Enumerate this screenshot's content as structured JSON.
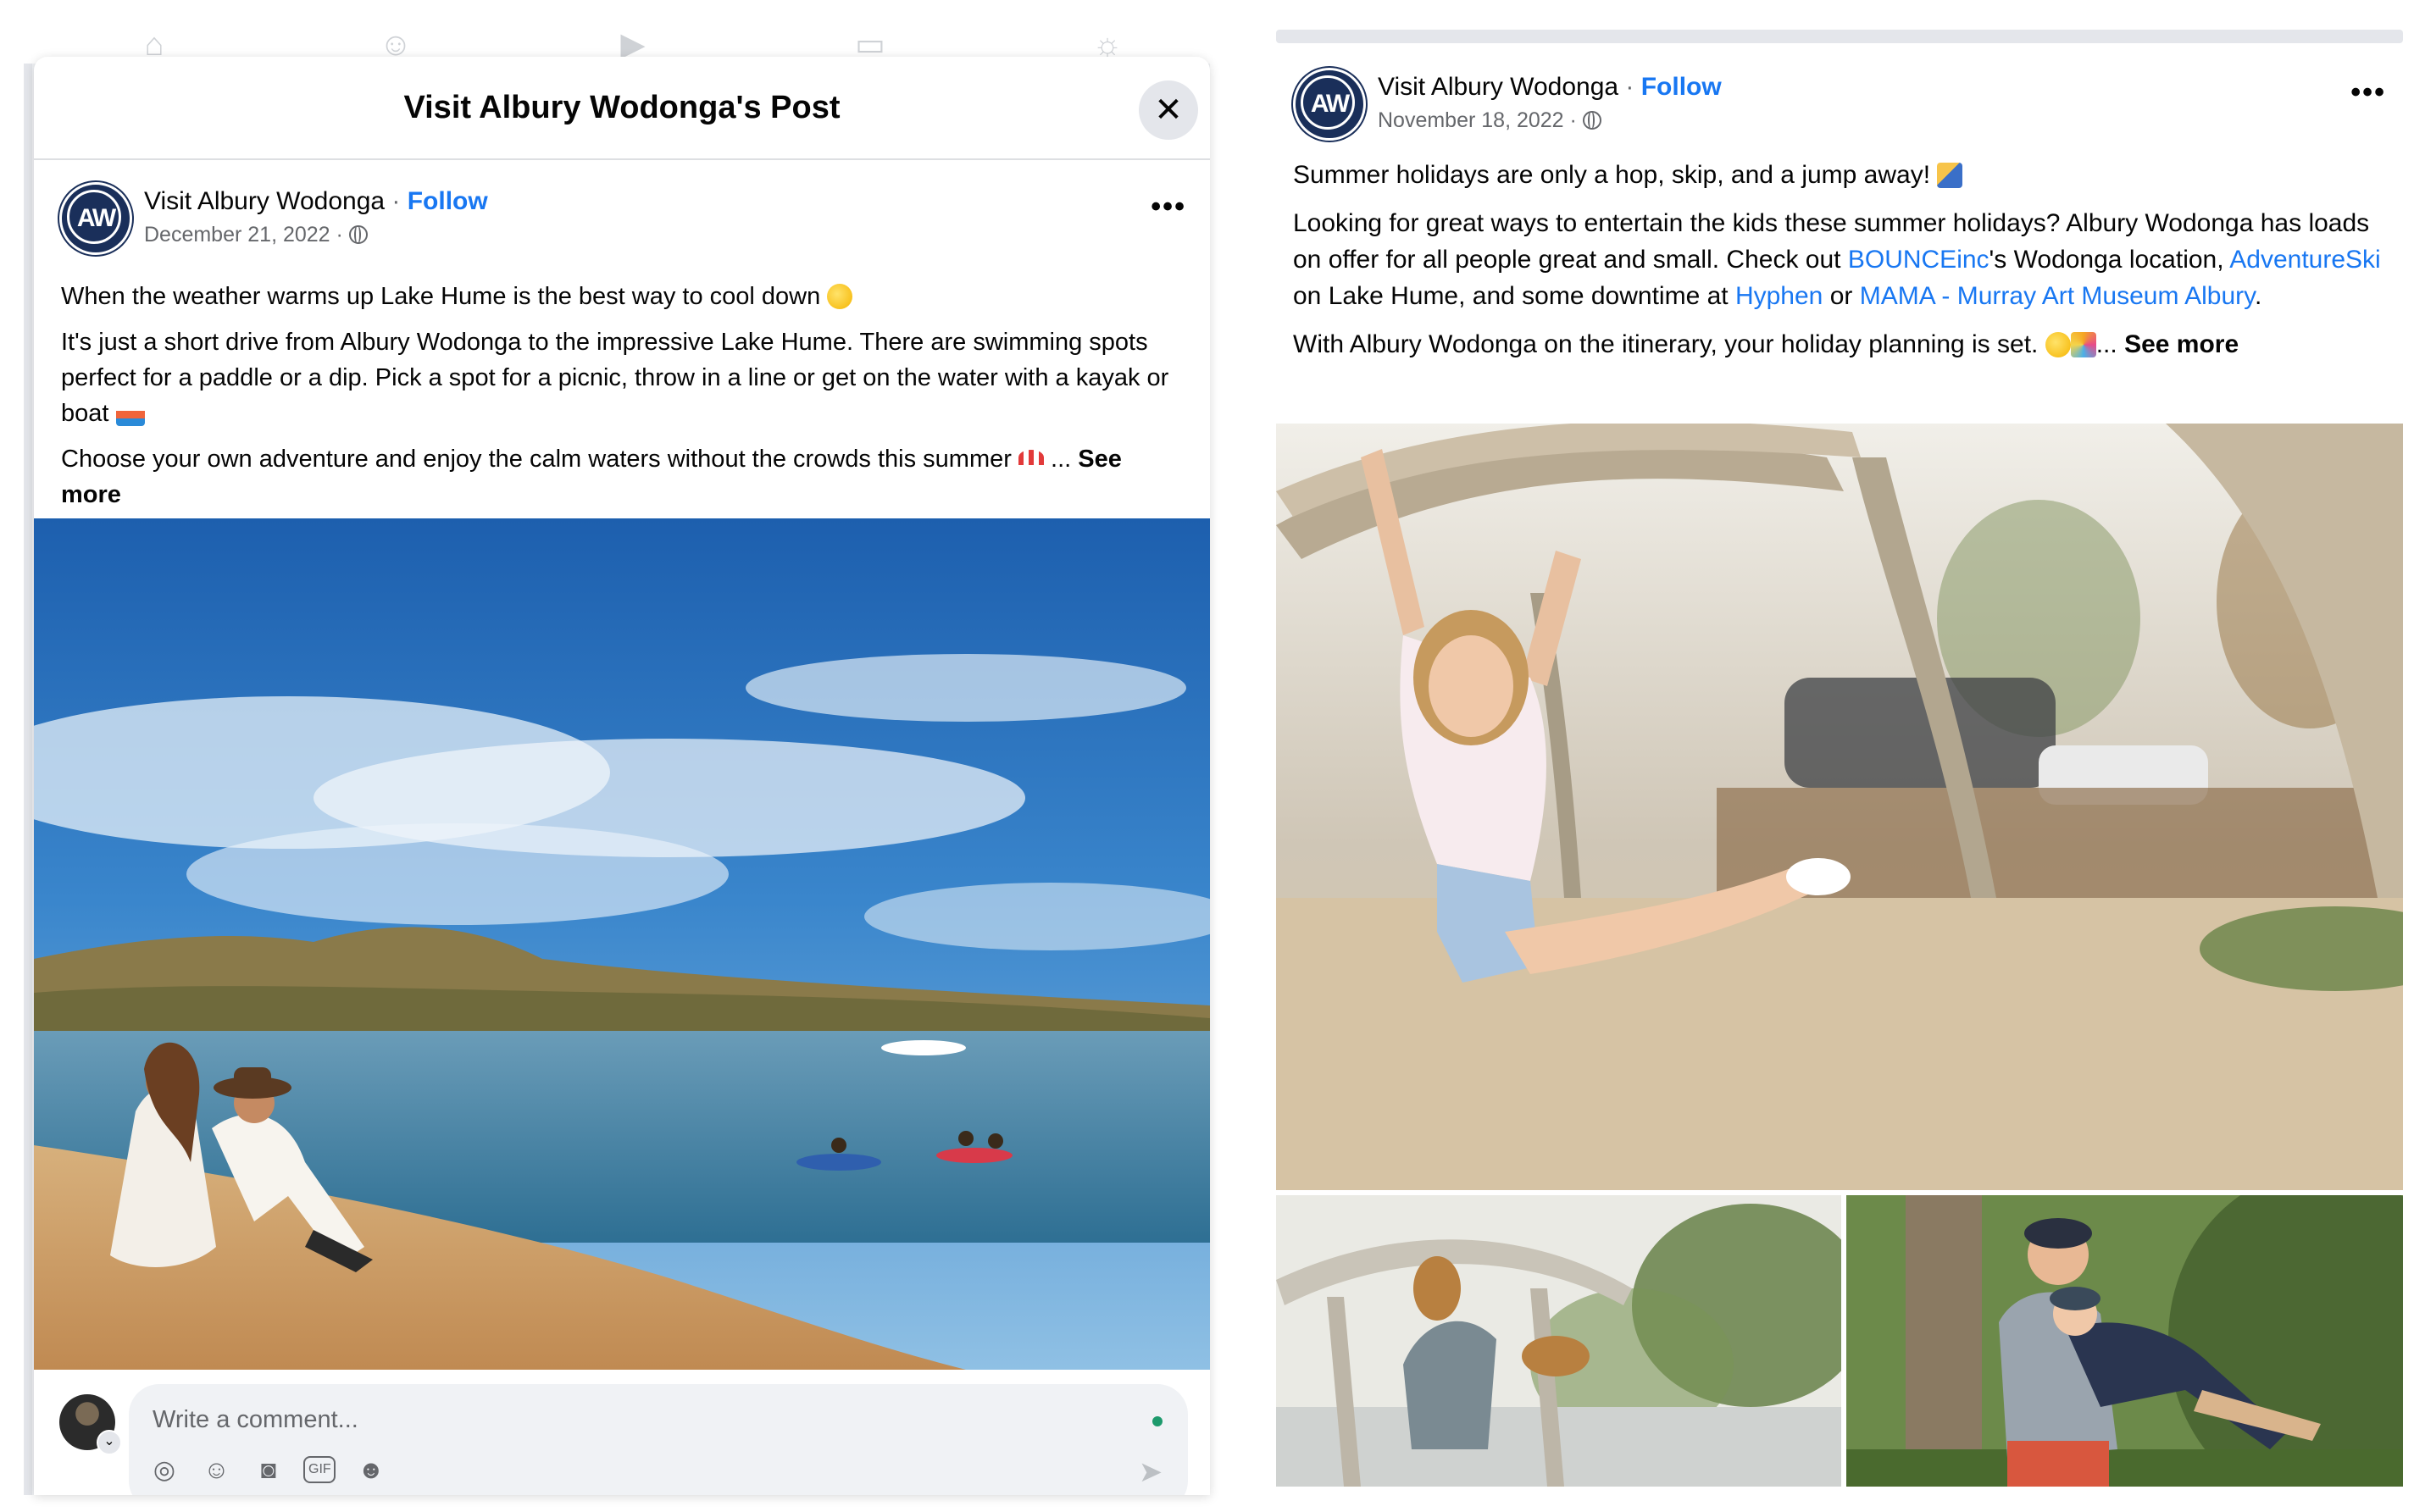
{
  "left_post": {
    "modal_title": "Visit Albury Wodonga's Post",
    "avatar_text": "AW",
    "page_name": "Visit Albury Wodonga",
    "separator": " · ",
    "follow_label": "Follow",
    "date": "December 21, 2022 · ",
    "paragraph_1": "When the weather warms up Lake Hume is the best way to cool down",
    "paragraph_2": "It's just a short drive from Albury Wodonga to the impressive Lake Hume.  There are swimming spots perfect for a paddle or a dip. Pick a spot for a picnic, throw in a line or get on the water with a kayak or boat",
    "paragraph_3": "Choose your own adventure and enjoy the calm waters without the crowds this summer",
    "ellipsis": " ... ",
    "see_more": "See more",
    "comment_placeholder": "Write a comment...",
    "icons": [
      "home-icon",
      "friends-icon",
      "watch-icon",
      "marketplace-icon",
      "groups-icon",
      "close-icon",
      "more-icon",
      "globe-icon",
      "sticker-icon",
      "emoji-icon",
      "camera-icon",
      "gif-icon",
      "avatar-sticker-icon",
      "send-icon"
    ]
  },
  "right_post": {
    "avatar_text": "AW",
    "page_name": "Visit Albury Wodonga",
    "separator": " · ",
    "follow_label": "Follow",
    "date": "November 18, 2022 · ",
    "paragraph_1": "Summer holidays are only a hop, skip, and a jump away!",
    "p2_part1": "Looking for great ways to entertain the kids these summer holidays? Albury Wodonga has loads on offer for all people great and small. Check out ",
    "p2_link1": "BOUNCEinc",
    "p2_part2": "'s Wodonga location, ",
    "p2_link2": "AdventureSki",
    "p2_part3": " on Lake Hume, and some downtime at ",
    "p2_link3": "Hyphen",
    "p2_part4": " or ",
    "p2_link4": "MAMA - Murray Art Museum Albury",
    "p2_part5": ".",
    "paragraph_3": "With Albury Wodonga on the itinerary, your holiday planning is set.",
    "ellipsis": "... ",
    "see_more": "See more"
  },
  "colors": {
    "link_blue": "#1877f2",
    "avatar_navy": "#1a2f5a",
    "secondary_text": "#65676b"
  }
}
